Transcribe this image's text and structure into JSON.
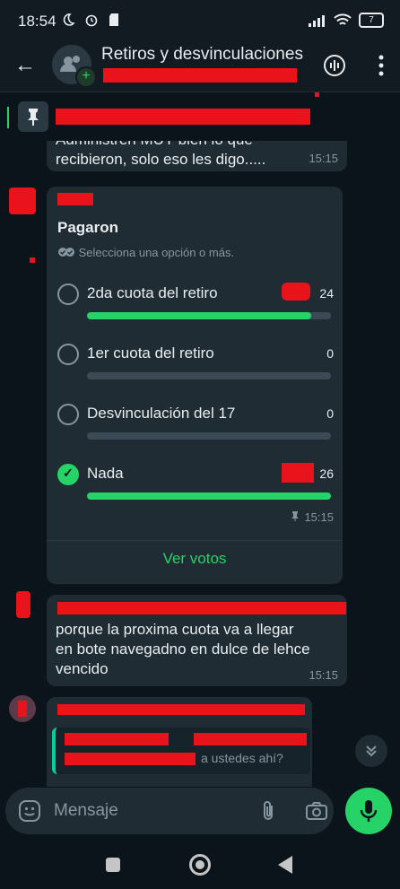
{
  "status_bar": {
    "time": "18:54",
    "battery": "7"
  },
  "header": {
    "title": "Retiros y desvinculaciones"
  },
  "messages": [
    {
      "text_line1": "Administren MUY bien lo que",
      "text_line2": "recibieron, solo eso les digo.....",
      "time": "15:15"
    },
    {
      "text_line1": "porque la proxima cuota va a llegar",
      "text_line2": "en bote navegadno en dulce de lehce",
      "text_line3": "vencido",
      "time": "15:15"
    },
    {
      "quote_text": "a ustedes ahí?"
    }
  ],
  "poll": {
    "title": "Pagaron",
    "instruction": "Selecciona una opción o más.",
    "options": [
      {
        "label": "2da cuota del retiro",
        "votes": "24",
        "fraction": 0.92,
        "checked": false
      },
      {
        "label": "1er cuota del retiro",
        "votes": "0",
        "fraction": 0,
        "checked": false
      },
      {
        "label": "Desvinculación del 17",
        "votes": "0",
        "fraction": 0,
        "checked": false
      },
      {
        "label": "Nada",
        "votes": "26",
        "fraction": 1.0,
        "checked": true
      }
    ],
    "time": "15:15",
    "view_votes": "Ver votos"
  },
  "composer": {
    "placeholder": "Mensaje"
  },
  "colors": {
    "accent": "#25d366",
    "bubble": "#1f2c34",
    "background": "#0b141a",
    "redaction": "#e8131b"
  }
}
